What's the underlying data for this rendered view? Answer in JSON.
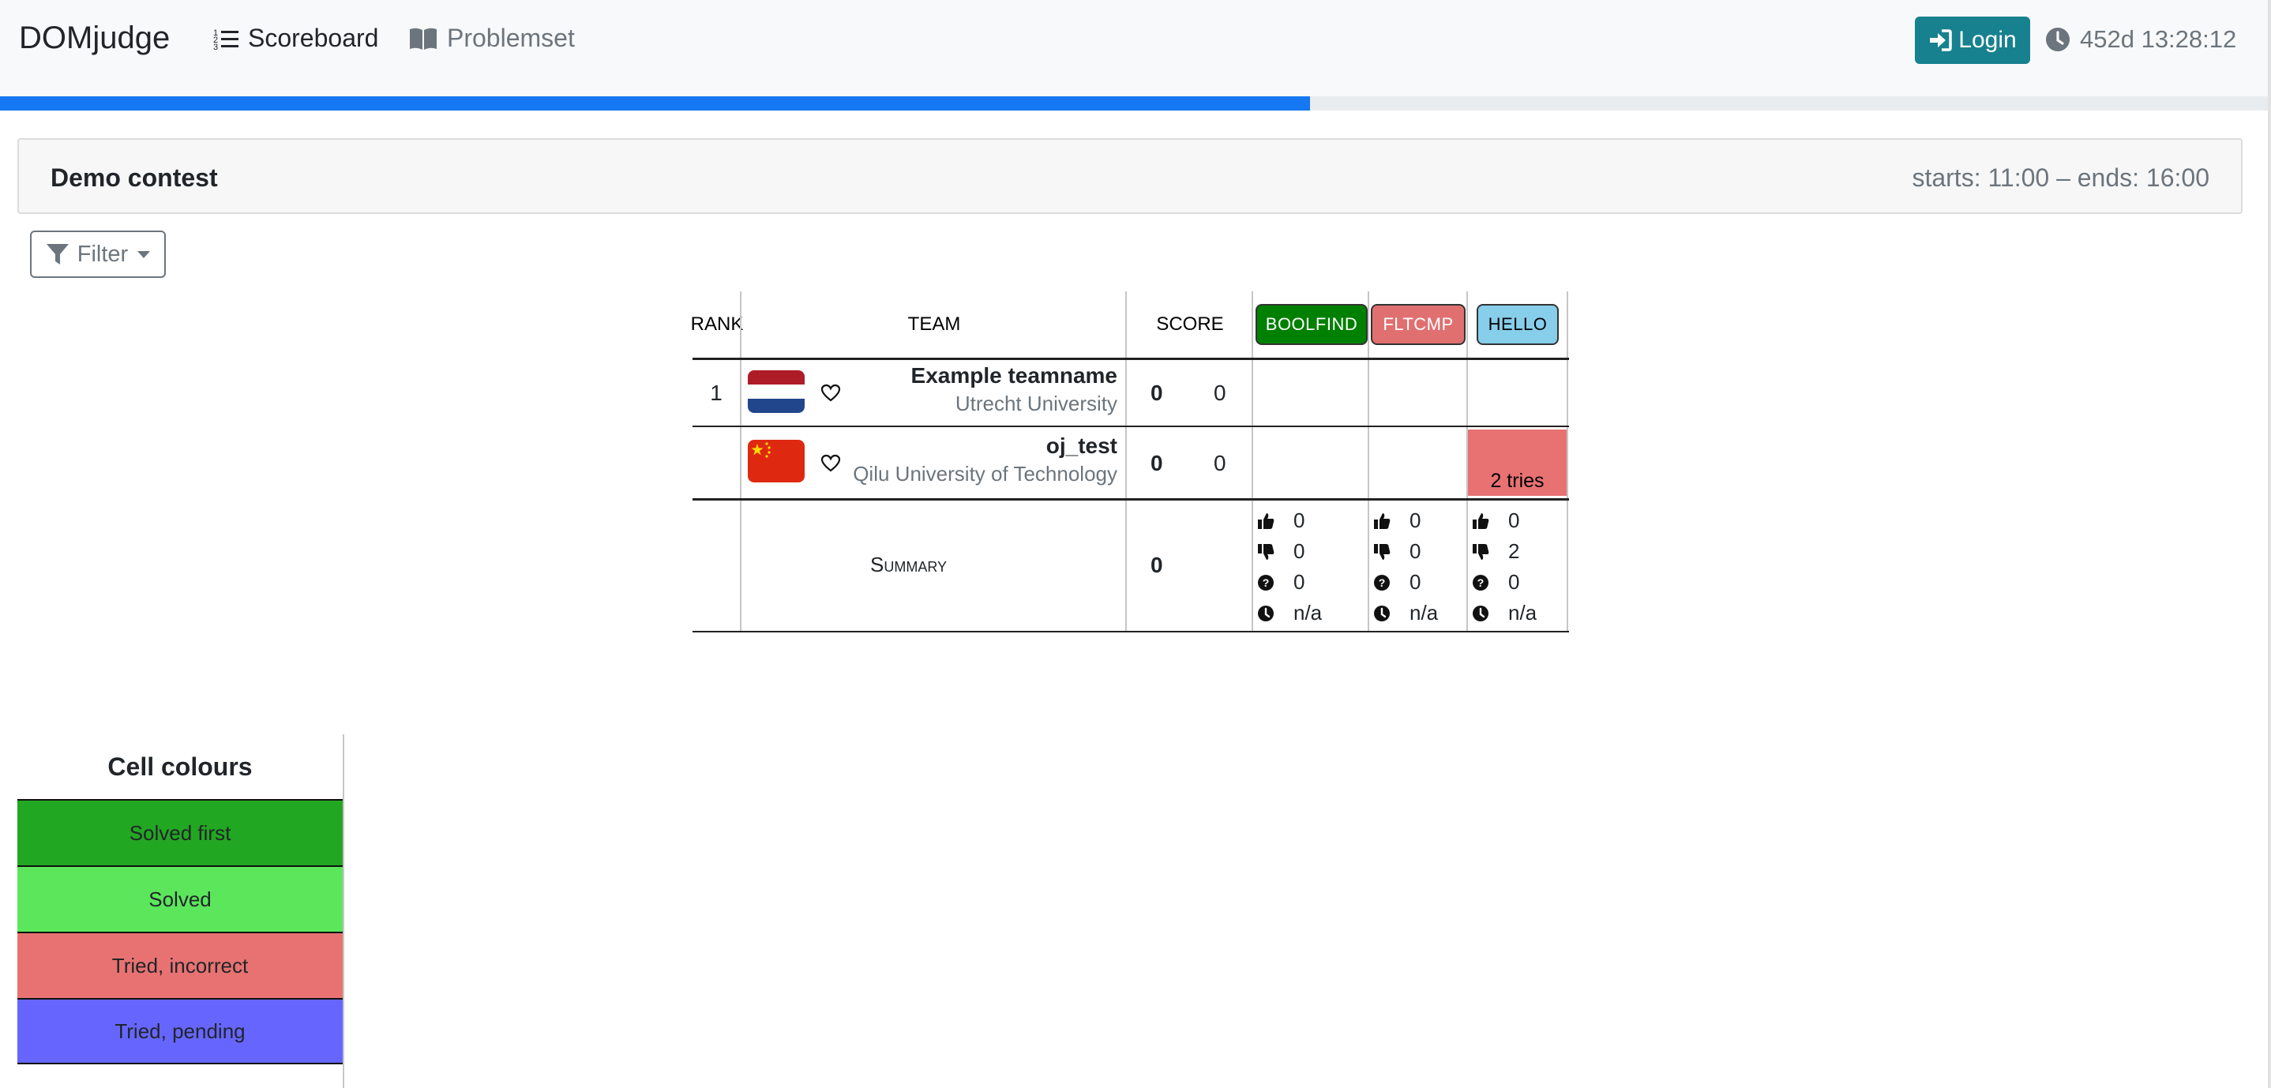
{
  "navbar": {
    "brand": "DOMjudge",
    "links": {
      "scoreboard": "Scoreboard",
      "problemset": "Problemset"
    },
    "login_label": "Login",
    "clock": "452d 13:28:12",
    "contest_progress": 0.577
  },
  "contest": {
    "name": "Demo contest",
    "times": "starts: 11:00 – ends: 16:00"
  },
  "filter": {
    "label": "Filter"
  },
  "scoreboard": {
    "headers": {
      "rank": "RANK",
      "team": "TEAM",
      "score": "SCORE"
    },
    "problems": [
      {
        "label": "BOOLFIND",
        "color": "#008000",
        "text_color": "#ffffff"
      },
      {
        "label": "FLTCMP",
        "color": "#e07070",
        "text_color": "#ffffff"
      },
      {
        "label": "HELLO",
        "color": "#87ceeb",
        "text_color": "#000000"
      }
    ],
    "teams": [
      {
        "rank": "1",
        "name": "Example teamname",
        "affiliation": "Utrecht University",
        "flag": "netherlands-flag",
        "solved": "0",
        "penalty": "0",
        "problem_cells": [
          "",
          "",
          ""
        ]
      },
      {
        "rank": "",
        "name": "oj_test",
        "affiliation": "Qilu University of Technology",
        "flag": "china-flag",
        "solved": "0",
        "penalty": "0",
        "problem_cells": [
          "",
          "",
          "2 tries"
        ]
      }
    ],
    "summary": {
      "label": "Summary",
      "score": "0",
      "problems": [
        {
          "correct": "0",
          "incorrect": "0",
          "pending": "0",
          "first_time": "n/a"
        },
        {
          "correct": "0",
          "incorrect": "0",
          "pending": "0",
          "first_time": "n/a"
        },
        {
          "correct": "0",
          "incorrect": "2",
          "pending": "0",
          "first_time": "n/a"
        }
      ]
    }
  },
  "legend": {
    "title": "Cell colours",
    "items": [
      {
        "label": "Solved first",
        "color": "#22a722"
      },
      {
        "label": "Solved",
        "color": "#5ce65c"
      },
      {
        "label": "Tried, incorrect",
        "color": "#e87272"
      },
      {
        "label": "Tried, pending",
        "color": "#6666ff"
      }
    ]
  }
}
